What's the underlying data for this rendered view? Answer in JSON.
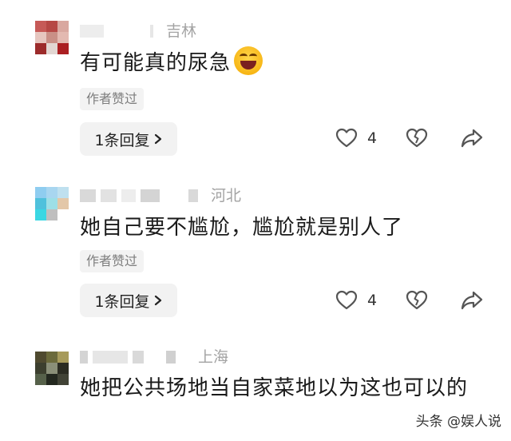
{
  "comments": [
    {
      "region": "吉林",
      "text": "有可能真的尿急",
      "emoji": "laughing-emoji",
      "badge": "作者赞过",
      "reply_label": "1条回复",
      "like_count": "4",
      "avatar_colors": [
        "#c65a57",
        "#b64845",
        "#d9a8a0",
        "#e6c6bf",
        "#c98f86",
        "#e3b9b1",
        "#9c2b2b",
        "#e2d6d2",
        "#ab1f22"
      ]
    },
    {
      "region": "河北",
      "text": "她自己要不尴尬，尴尬就是别人了",
      "badge": "作者赞过",
      "reply_label": "1条回复",
      "like_count": "4",
      "avatar_colors": [
        "#8fcdf0",
        "#a8d6f0",
        "#bfe0ef",
        "#4fc1dc",
        "#9ddfe6",
        "#e3c7a8",
        "#3ad7e3",
        "#bfbfbf",
        "#ffffff"
      ]
    },
    {
      "region": "上海",
      "text": "她把公共场地当自家菜地以为这也可以的",
      "avatar_colors": [
        "#4f4a2f",
        "#6b6a3b",
        "#a79b5b",
        "#3c3f2e",
        "#8a8f78",
        "#2b2c22",
        "#56614a",
        "#23281f",
        "#414336"
      ]
    }
  ],
  "watermark": "头条 @娱人说",
  "colors": {
    "like_icon": "#555555",
    "blur_dark": "#d9d9d9",
    "blur_light": "#ededed"
  }
}
